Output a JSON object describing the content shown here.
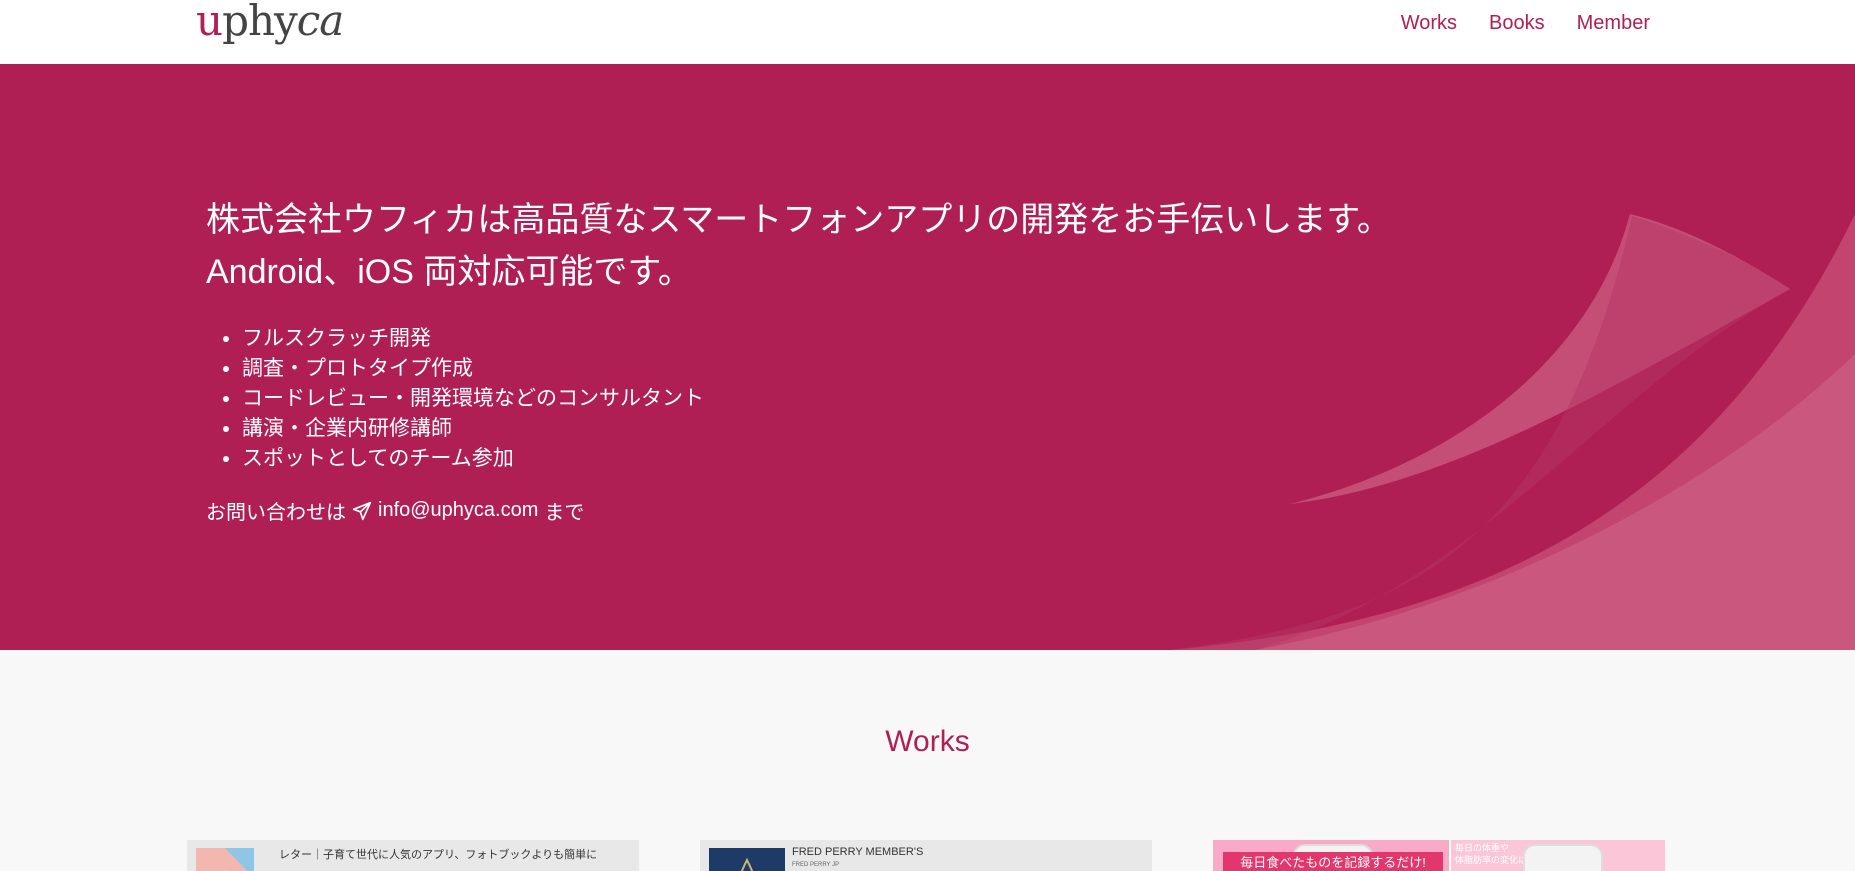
{
  "header": {
    "logo": {
      "u": "u",
      "phy": "phy",
      "ca": "ca"
    },
    "nav": [
      "Works",
      "Books",
      "Member"
    ]
  },
  "hero": {
    "title_line1": "株式会社ウフィカは高品質なスマートフォンアプリの開発をお手伝いします。",
    "title_line2": "Android、iOS 両対応可能です。",
    "services": [
      "フルスクラッチ開発",
      "調査・プロトタイプ作成",
      "コードレビュー・開発環境などのコンサルタント",
      "講演・企業内研修講師",
      "スポットとしてのチーム参加"
    ],
    "contact_prefix": "お問い合わせは",
    "contact_email": "info@uphyca.com",
    "contact_suffix": "まで"
  },
  "works": {
    "title": "Works",
    "cards": [
      {
        "title": "レター｜子育て世代に人気のアプリ、フォトブックよりも簡単に"
      },
      {
        "title": "FRED PERRY MEMBER'S",
        "subtitle": "FRED PERRY JP"
      },
      {
        "banner": "毎日食べたものを記録するだけ!",
        "side_line1": "毎日の体重や",
        "side_line2": "体脂肪率の変化は"
      }
    ]
  },
  "colors": {
    "brand": "#b01f54",
    "accent_text": "#b01e55",
    "background": "#f8f8f8"
  }
}
